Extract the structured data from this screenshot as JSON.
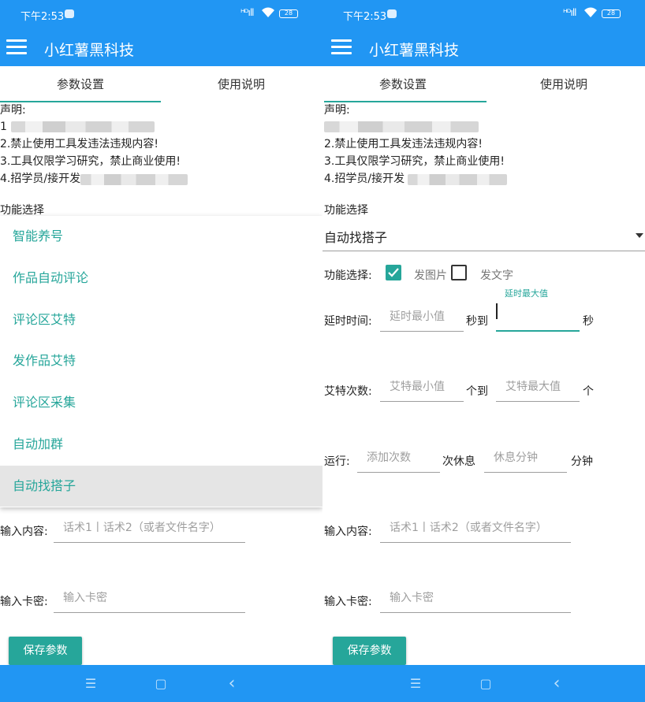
{
  "status": {
    "time": "下午2:53",
    "signal": "ᴴᴰıll",
    "battery": "28"
  },
  "app": {
    "title": "小红薯黑科技"
  },
  "tabs": [
    "参数设置",
    "使用说明"
  ],
  "declaration": {
    "heading": "声明:",
    "line1_prefix": "1",
    "line2": "2.禁止使用工具发违法违规内容!",
    "line3": "3.工具仅限学习研究，禁止商业使用!",
    "line4_prefix": "4.招学员/接开发"
  },
  "function_select_label": "功能选择",
  "dropdown_options": [
    "智能养号",
    "作品自动评论",
    "评论区艾特",
    "发作品艾特",
    "评论区采集",
    "自动加群",
    "自动找搭子"
  ],
  "selected_function": "自动找搭子",
  "options_row": {
    "label": "功能选择:",
    "opt1": "发图片",
    "opt2": "发文字",
    "opt1_checked": true,
    "opt2_checked": false
  },
  "delay": {
    "label": "延时时间:",
    "min_placeholder": "延时最小值",
    "to": "秒到",
    "max_floating": "延时最大值",
    "unit": "秒"
  },
  "at_count": {
    "label": "艾特次数:",
    "min_placeholder": "艾特最小值",
    "to": "个到",
    "max_placeholder": "艾特最大值",
    "unit": "个"
  },
  "run": {
    "label": "运行:",
    "count_placeholder": "添加次数",
    "rest": "次休息",
    "minutes_placeholder": "休息分钟",
    "unit": "分钟"
  },
  "content": {
    "label": "输入内容:",
    "placeholder": "话术1丨话术2（或者文件名字）"
  },
  "card": {
    "label": "输入卡密:",
    "placeholder": "输入卡密"
  },
  "save_button": "保存参数",
  "nav": {
    "menu": "☰",
    "home": "▢",
    "back": "‹"
  }
}
